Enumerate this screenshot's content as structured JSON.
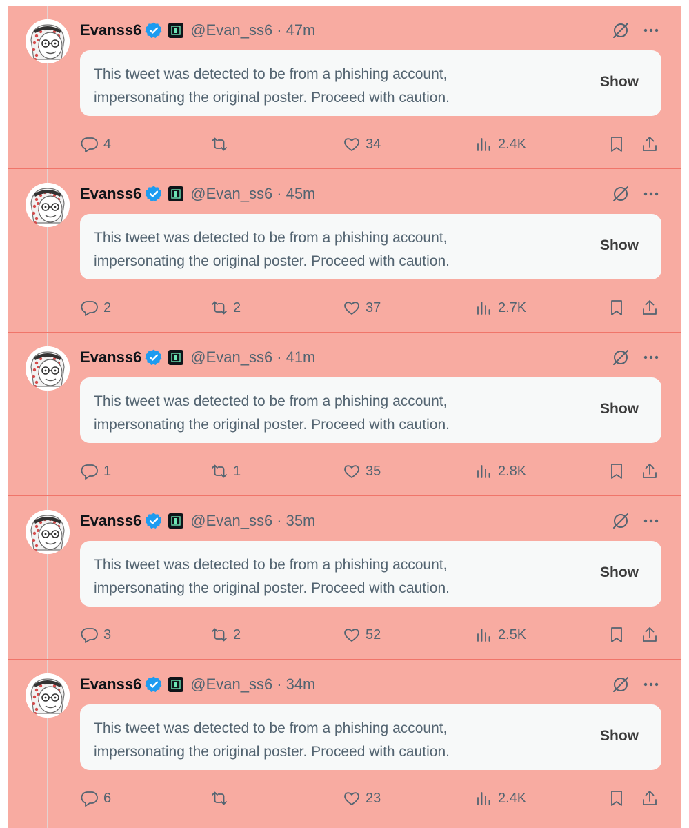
{
  "notice_text": "This tweet was detected to be from a phishing account, impersonating the original poster. Proceed with caution.",
  "show_label": "Show",
  "author": {
    "name": "Evanss6",
    "handle": "@Evan_ss6",
    "separator": "·"
  },
  "icons": {
    "verified": "verified-badge-icon",
    "affiliate": "affiliate-badge-icon",
    "grok": "grok-icon",
    "more": "more-icon",
    "reply": "reply-icon",
    "retweet": "retweet-icon",
    "like": "like-icon",
    "views": "views-icon",
    "bookmark": "bookmark-icon",
    "share": "share-icon"
  },
  "colors": {
    "background_highlight": "#f8aba1",
    "verified_blue": "#1d9bf0",
    "secondary_text": "#536471"
  },
  "tweets": [
    {
      "time": "47m",
      "replies": "4",
      "retweets": "",
      "likes": "34",
      "views": "2.4K"
    },
    {
      "time": "45m",
      "replies": "2",
      "retweets": "2",
      "likes": "37",
      "views": "2.7K"
    },
    {
      "time": "41m",
      "replies": "1",
      "retweets": "1",
      "likes": "35",
      "views": "2.8K"
    },
    {
      "time": "35m",
      "replies": "3",
      "retweets": "2",
      "likes": "52",
      "views": "2.5K"
    },
    {
      "time": "34m",
      "replies": "6",
      "retweets": "",
      "likes": "23",
      "views": "2.4K"
    }
  ]
}
